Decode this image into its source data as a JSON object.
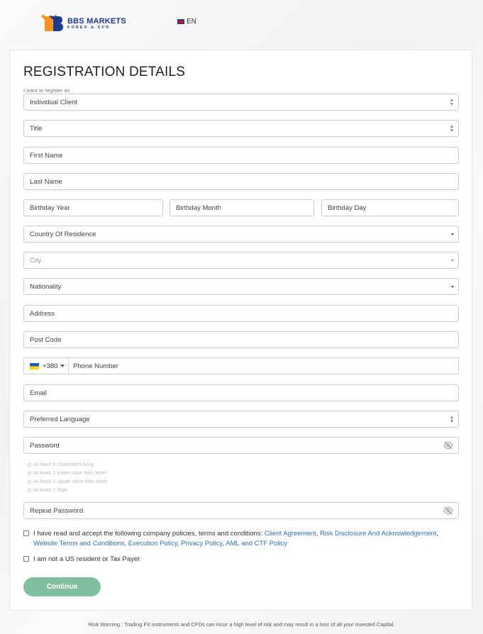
{
  "brand": {
    "name": "BBS MARKETS",
    "tagline": "FOREX & CFD"
  },
  "language": {
    "current": "EN"
  },
  "form": {
    "title": "REGISTRATION DETAILS",
    "register_as_label": "I want to register as",
    "register_as_value": "Individual Client",
    "title_select": "Title",
    "first_name": "First Name",
    "last_name": "Last Name",
    "birthday_year": "Birthday Year",
    "birthday_month": "Birthday Month",
    "birthday_day": "Birthday Day",
    "country": "Country Of Residence",
    "city": "City",
    "nationality": "Nationality",
    "address": "Address",
    "post_code": "Post Code",
    "phone_code": "+380",
    "phone_number": "Phone Number",
    "email": "Email",
    "preferred_language": "Preferred Language",
    "password": "Password",
    "password_hints": [
      "At least 8 characters long",
      "At least 1 lower case latin letter",
      "At least 1 upper case latin letter",
      "At least 1 digit"
    ],
    "repeat_password": "Repeat Password",
    "policies_intro": "I have read and accept the following company policies, terms and conditions: ",
    "policy_links": {
      "client_agreement": "Client Agreement",
      "risk_disclosure": "Risk Disclosure And Acknowledgement",
      "website_terms": "Website Terms and Conditions",
      "execution_policy": "Execution Policy",
      "privacy_policy": "Privacy Policy",
      "aml_policy": "AML and CTF Policy"
    },
    "us_resident": "I am not a US resident or Tax Payer",
    "continue_label": "Continue"
  },
  "footer": {
    "risk_warning": "Risk Warning : Trading FX instruments and CFDs can incur a high level of risk and may result in a loss of all your invested Capital."
  },
  "colors": {
    "accent": "#82bfa0",
    "link": "#2f6fb0",
    "brand": "#1e3a8a",
    "logo_orange": "#f7931e"
  }
}
